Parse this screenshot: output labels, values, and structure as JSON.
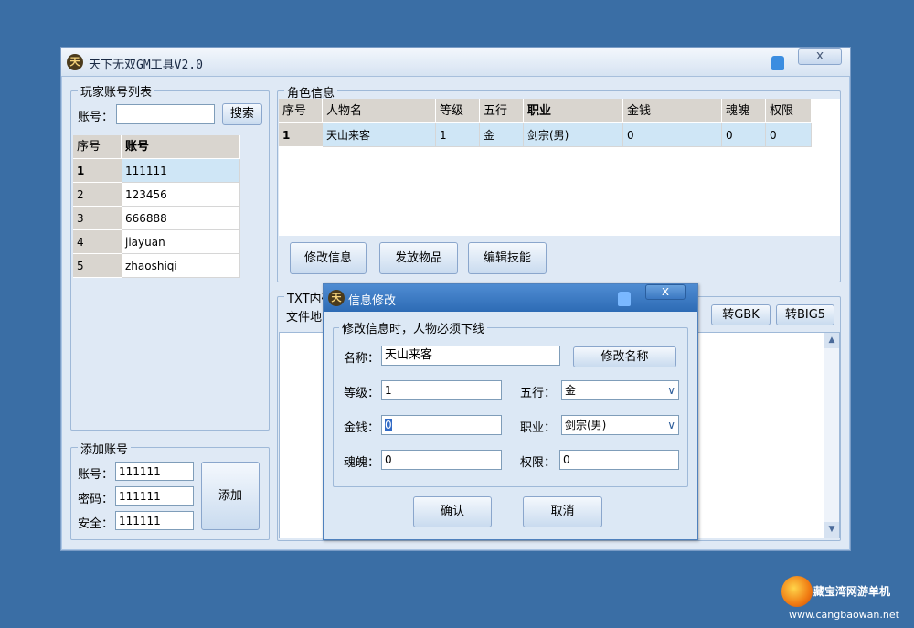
{
  "window": {
    "title": "天下无双GM工具V2.0",
    "close_label": "x"
  },
  "left_panel": {
    "group_title": "玩家账号列表",
    "account_label": "账号：",
    "account_value": "",
    "search_label": "搜索",
    "columns": [
      "序号",
      "账号"
    ],
    "rows": [
      {
        "no": "1",
        "account": "111111"
      },
      {
        "no": "2",
        "account": "123456"
      },
      {
        "no": "3",
        "account": "666888"
      },
      {
        "no": "4",
        "account": "jiayuan"
      },
      {
        "no": "5",
        "account": "zhaoshiqi"
      }
    ]
  },
  "add_account": {
    "group_title": "添加账号",
    "account_label": "账号：",
    "account_value": "111111",
    "password_label": "密码：",
    "password_value": "111111",
    "security_label": "安全：",
    "security_value": "111111",
    "add_label": "添加"
  },
  "role_panel": {
    "group_title": "角色信息",
    "columns": [
      "序号",
      "人物名",
      "等级",
      "五行",
      "职业",
      "金钱",
      "魂魄",
      "权限"
    ],
    "rows": [
      {
        "no": "1",
        "name": "天山来客",
        "level": "1",
        "element": "金",
        "job": "剑宗(男)",
        "money": "0",
        "soul": "0",
        "perm": "0"
      }
    ],
    "edit_info_label": "修改信息",
    "give_items_label": "发放物品",
    "edit_skills_label": "编辑技能"
  },
  "txt_panel": {
    "group_title": "TXT内码",
    "file_label": "文件地",
    "to_gbk_label": "转GBK",
    "to_big5_label": "转BIG5"
  },
  "dialog": {
    "title": "信息修改",
    "close_label": "x",
    "group_title": "修改信息时，人物必须下线",
    "name_label": "名称：",
    "name_value": "天山来客",
    "rename_label": "修改名称",
    "level_label": "等级：",
    "level_value": "1",
    "element_label": "五行：",
    "element_value": "金",
    "money_label": "金钱：",
    "money_value": "0",
    "job_label": "职业：",
    "job_value": "剑宗(男)",
    "soul_label": "魂魄：",
    "soul_value": "0",
    "perm_label": "权限：",
    "perm_value": "0",
    "ok_label": "确认",
    "cancel_label": "取消"
  },
  "watermark": {
    "name": "藏宝湾网游单机",
    "url": "www.cangbaowan.net"
  },
  "colors": {
    "desktop": "#3a6ea5",
    "window": "#dfe9f5",
    "selection": "#cfe6f6",
    "dialog_title": "#2d6bb5"
  }
}
